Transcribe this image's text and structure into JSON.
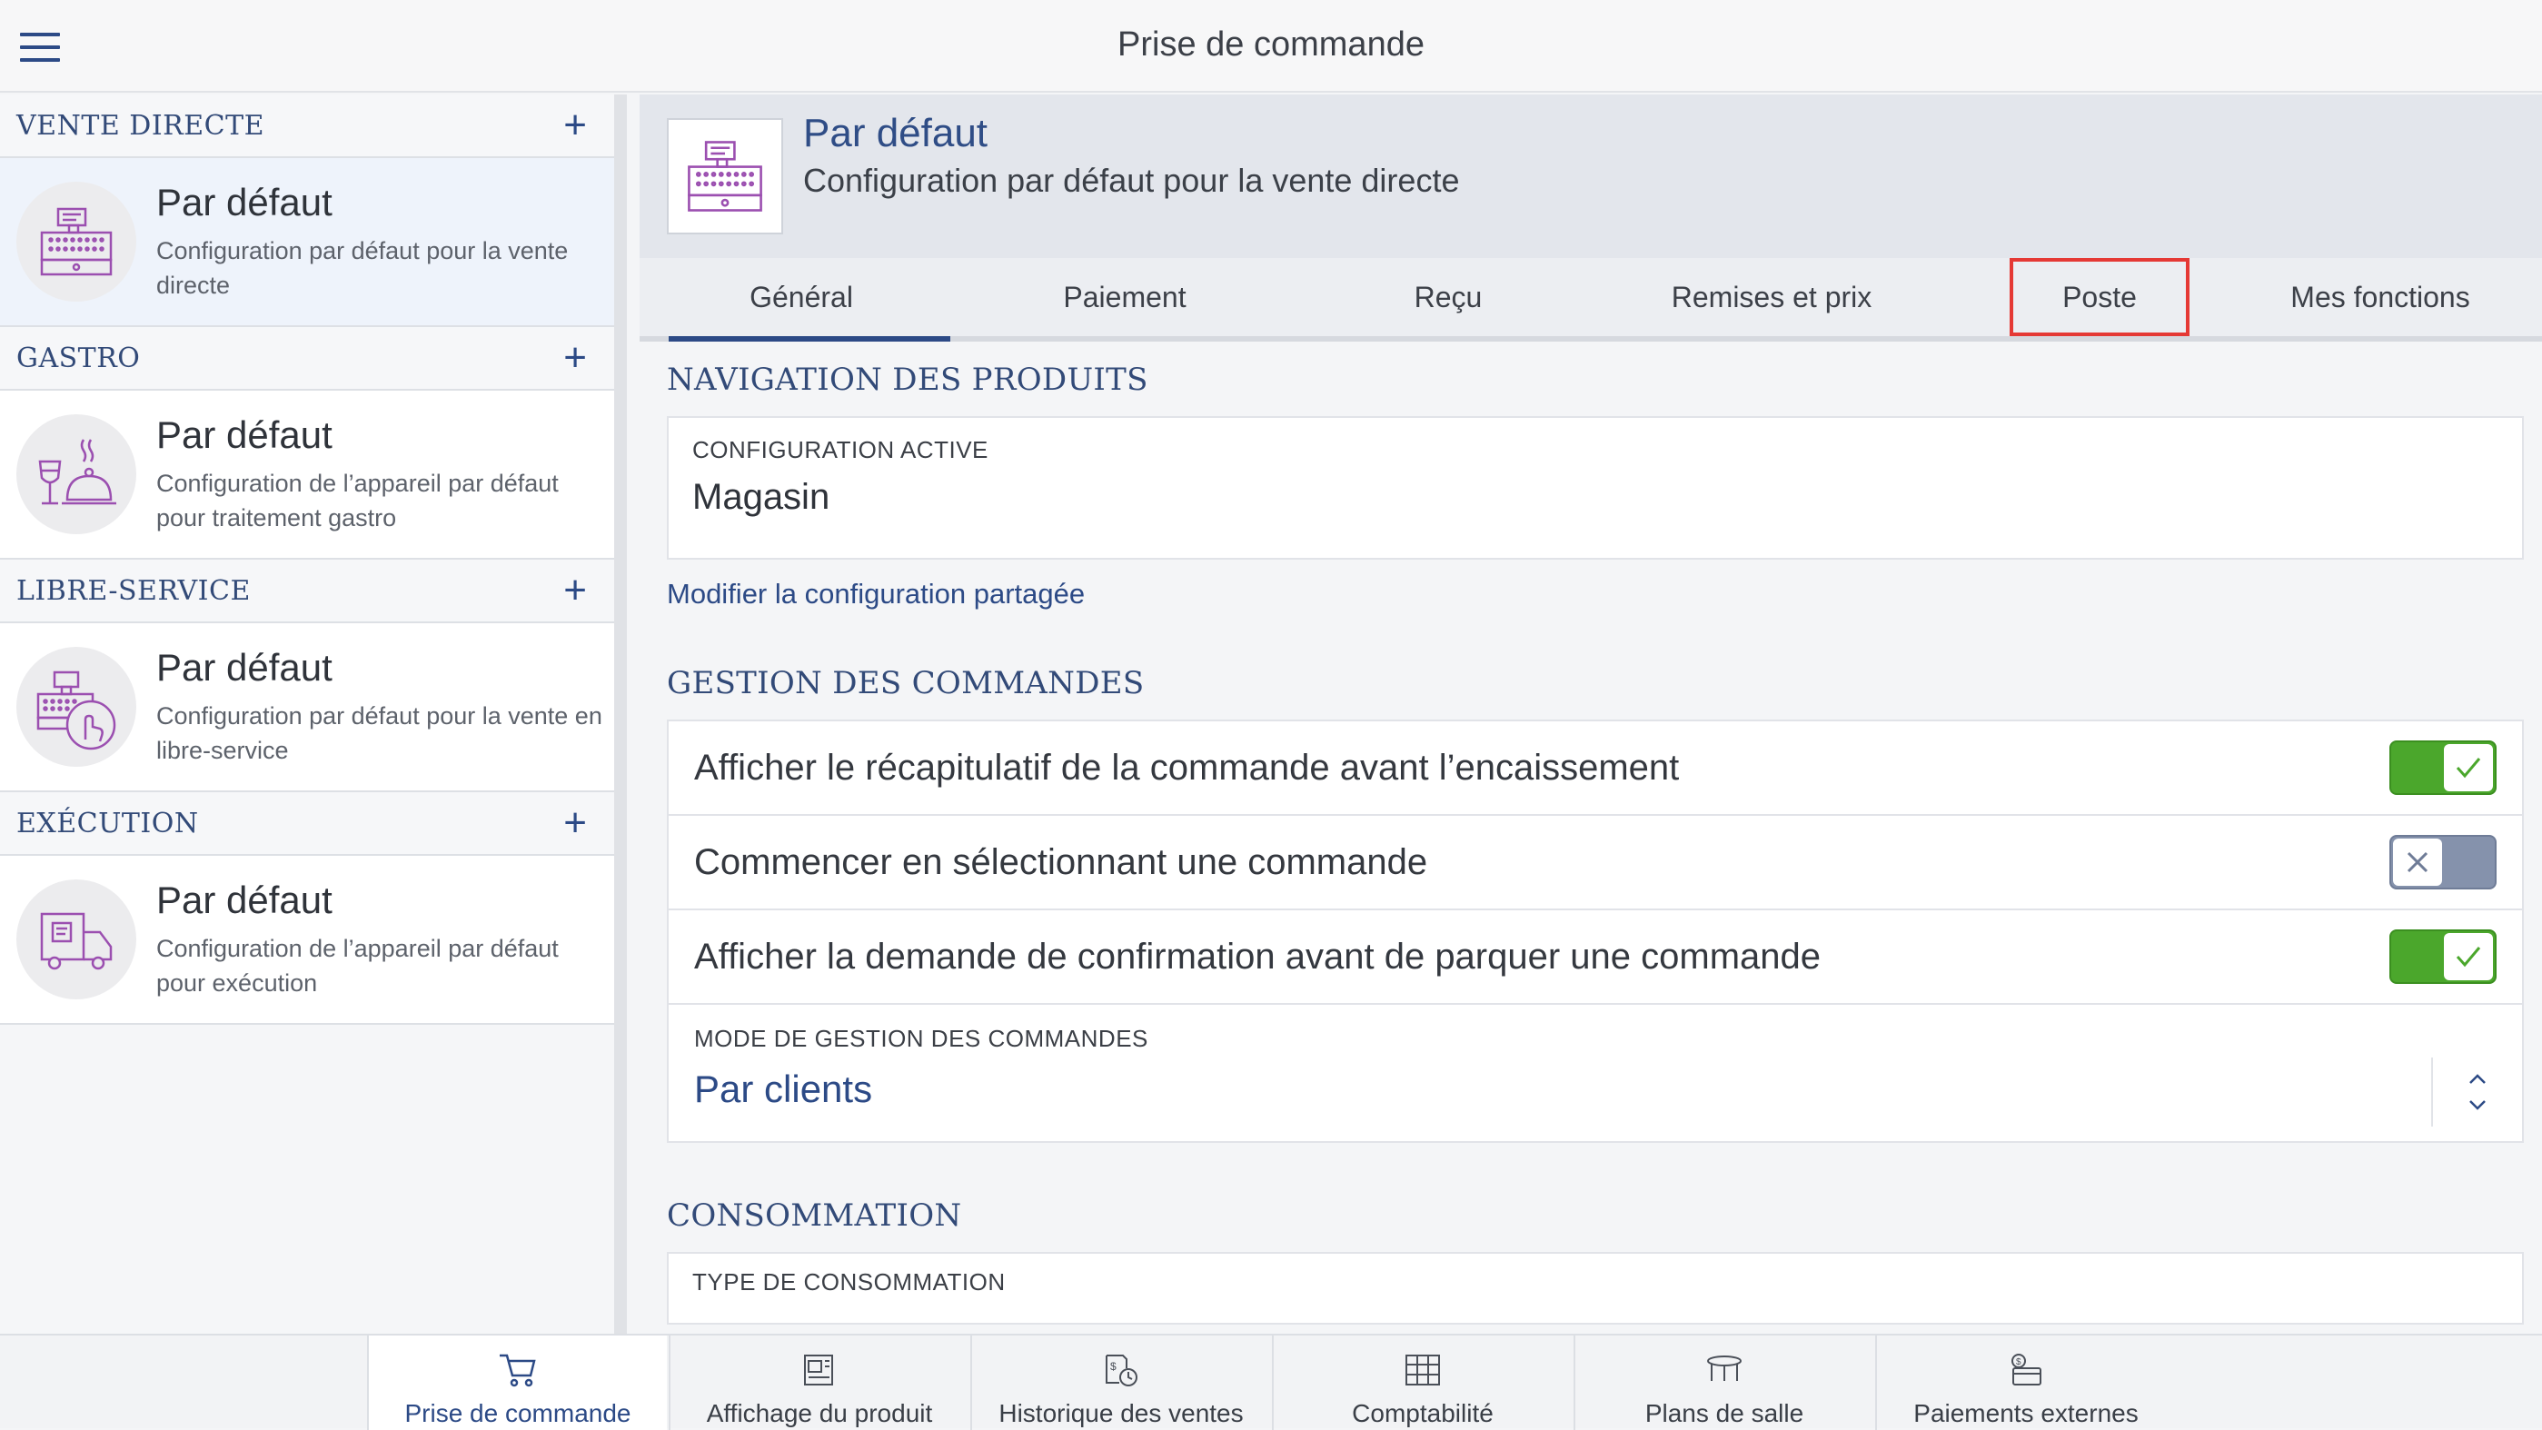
{
  "app": {
    "title": "Prise de commande"
  },
  "sidebar": {
    "sections": [
      {
        "title": "VENTE DIRECTE",
        "item": {
          "title": "Par défaut",
          "desc": "Configuration par défaut pour la vente directe",
          "icon": "cash-register-icon"
        }
      },
      {
        "title": "GASTRO",
        "item": {
          "title": "Par défaut",
          "desc": "Configuration de l’appareil par défaut pour traitement gastro",
          "icon": "wine-cloche-icon"
        }
      },
      {
        "title": "LIBRE-SERVICE",
        "item": {
          "title": "Par défaut",
          "desc": "Configuration par défaut pour la vente en libre-service",
          "icon": "self-service-register-icon"
        }
      },
      {
        "title": "EXÉCUTION",
        "item": {
          "title": "Par défaut",
          "desc": "Configuration de l’appareil par défaut pour exécution",
          "icon": "delivery-truck-icon"
        }
      }
    ]
  },
  "header": {
    "title": "Par défaut",
    "subtitle": "Configuration par défaut pour la vente directe"
  },
  "tabs": [
    "Général",
    "Paiement",
    "Reçu",
    "Remises et prix",
    "Poste",
    "Mes fonctions"
  ],
  "active_tab": "Général",
  "highlighted_tab": "Poste",
  "navigation": {
    "section_title": "NAVIGATION DES PRODUITS",
    "field_label": "CONFIGURATION ACTIVE",
    "field_value": "Magasin",
    "link": "Modifier la configuration partagée"
  },
  "orders": {
    "section_title": "GESTION DES COMMANDES",
    "toggles": [
      {
        "label": "Afficher le récapitulatif de la commande avant l’encaissement",
        "on": true
      },
      {
        "label": "Commencer en sélectionnant une commande",
        "on": false
      },
      {
        "label": "Afficher la demande de confirmation avant de parquer une commande",
        "on": true
      }
    ],
    "mode_label": "MODE DE GESTION DES COMMANDES",
    "mode_value": "Par clients"
  },
  "consumption": {
    "section_title": "CONSOMMATION",
    "field_label": "TYPE DE CONSOMMATION"
  },
  "bottom_nav": [
    {
      "label": "Prise de commande",
      "icon": "cart-icon",
      "active": true
    },
    {
      "label": "Affichage du produit",
      "icon": "product-display-icon",
      "active": false
    },
    {
      "label": "Historique des ventes",
      "icon": "sales-history-icon",
      "active": false
    },
    {
      "label": "Comptabilité",
      "icon": "accounting-icon",
      "active": false
    },
    {
      "label": "Plans de salle",
      "icon": "table-icon",
      "active": false
    },
    {
      "label": "Paiements externes",
      "icon": "external-payment-icon",
      "active": false
    }
  ],
  "colors": {
    "accent": "#2c4a86",
    "toggle_on": "#4ba72c",
    "toggle_off": "#8592ac",
    "highlight": "#e53935",
    "icon_purple": "#9b4fb0"
  }
}
